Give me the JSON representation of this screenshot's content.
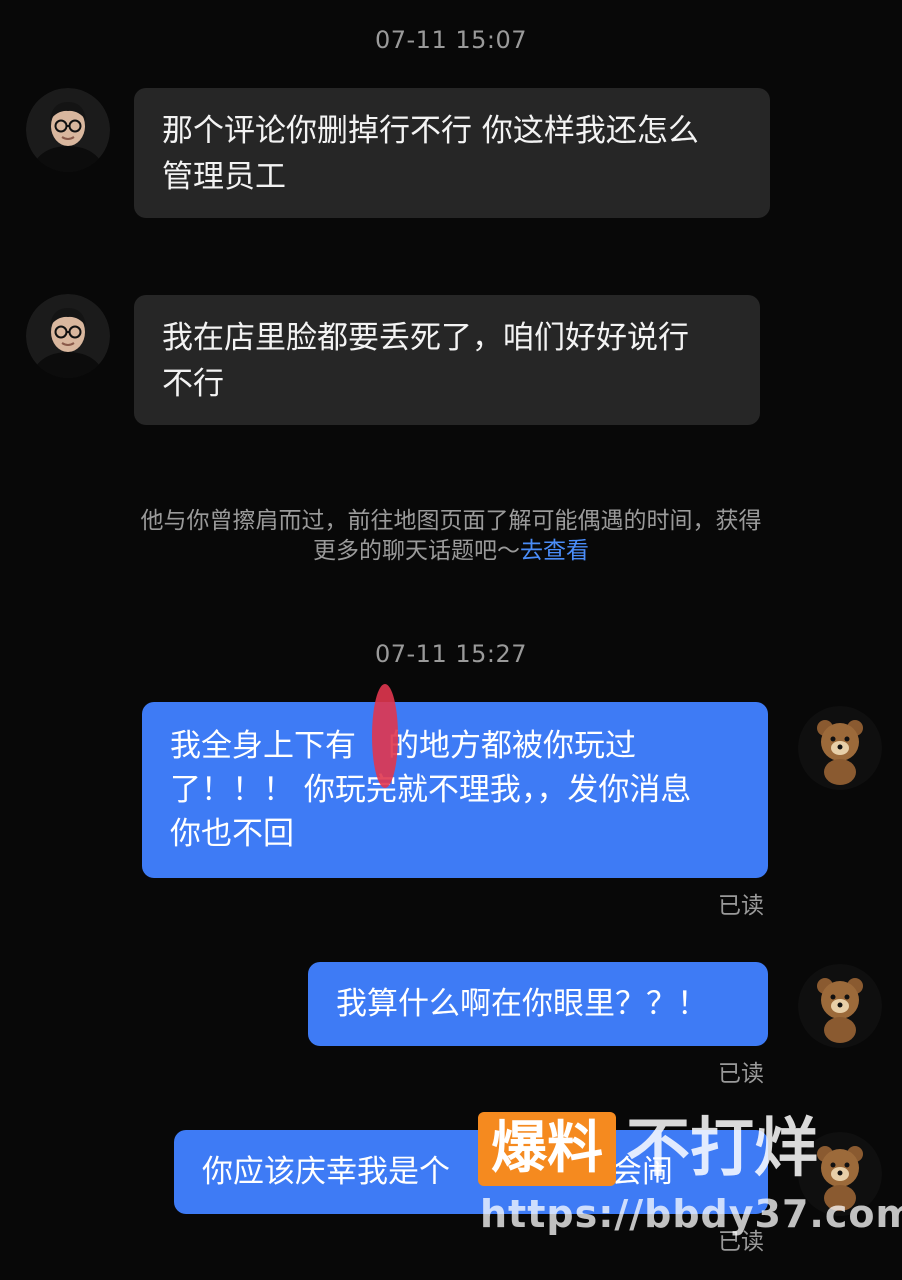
{
  "messages": [
    {
      "type": "timestamp",
      "text": "07-11 15:07"
    },
    {
      "type": "incoming",
      "lines": [
        "那个评论你删掉行不行 你这样我还怎么",
        "管理员工"
      ]
    },
    {
      "type": "incoming",
      "lines": [
        "我在店里脸都要丢死了，咱们好好说行",
        "不行"
      ]
    },
    {
      "type": "notice",
      "line1": "他与你曾擦肩而过，前往地图页面了解可能偶遇的时间，获得",
      "line2": "更多的聊天话题吧～",
      "link": "去查看"
    },
    {
      "type": "timestamp",
      "text": "07-11 15:27"
    },
    {
      "type": "outgoing",
      "lines": [
        "我全身上下有",
        "的地方都被你玩过",
        "了！！！ 你玩完就不理我，，发你消息",
        "你也不回"
      ],
      "status": "已读"
    },
    {
      "type": "outgoing",
      "lines": [
        "我算什么啊在你眼里？？！"
      ],
      "status": "已读"
    },
    {
      "type": "outgoing",
      "lines": [
        "你应该庆幸我是个",
        "不会",
        "闹"
      ],
      "status": "已读"
    }
  ],
  "watermark": {
    "badge": "爆料",
    "brand": "不打烊",
    "url": "https://bbdy37.com",
    "brand_color": "#f58a1f"
  },
  "colors": {
    "background": "#080808",
    "incoming_bubble": "#262626",
    "outgoing_bubble": "#3e7bf5",
    "link": "#4a8cf7"
  },
  "icons": {
    "incoming_avatar": "man-with-glasses-avatar",
    "outgoing_avatar": "teddy-bear-avatar"
  }
}
